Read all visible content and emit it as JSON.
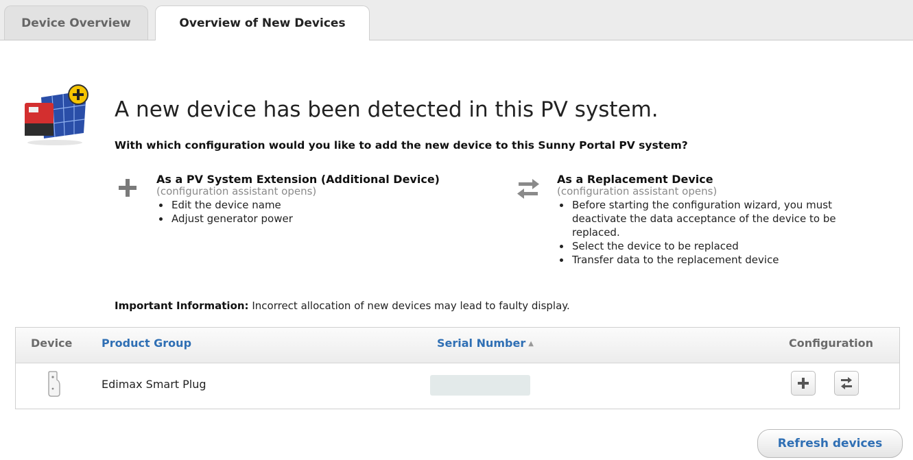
{
  "tabs": [
    {
      "label": "Device Overview",
      "active": false
    },
    {
      "label": "Overview of New Devices",
      "active": true
    }
  ],
  "hero": {
    "icon": "new-device-icon",
    "headline": "A new device has been detected in this PV system.",
    "question": "With which configuration would you like to add the new device to this Sunny Portal PV system?"
  },
  "options": {
    "extension": {
      "icon": "plus-icon",
      "title": "As a PV System Extension (Additional Device)",
      "subtitle": "(configuration assistant opens)",
      "items": [
        "Edit the device name",
        "Adjust generator power"
      ]
    },
    "replacement": {
      "icon": "swap-arrows-icon",
      "title": "As a Replacement Device",
      "subtitle": "(configuration assistant opens)",
      "items": [
        "Before starting the configuration wizard, you must deactivate the data acceptance of the device to be replaced.",
        "Select the device to be replaced",
        "Transfer data to the replacement device"
      ]
    }
  },
  "important": {
    "label": "Important Information:",
    "text": "Incorrect allocation of new devices may lead to faulty display."
  },
  "table": {
    "columns": {
      "device": "Device",
      "product_group": "Product Group",
      "serial_number": "Serial Number",
      "configuration": "Configuration"
    },
    "sort_icon": "sort-ascending-icon",
    "rows": [
      {
        "device_icon": "smart-plug-icon",
        "product_group": "Edimax Smart Plug",
        "serial_number": ""
      }
    ]
  },
  "refresh_button": "Refresh devices",
  "colors": {
    "link": "#2f6fb4",
    "accent": "#f5c400",
    "device_red": "#d32f2f",
    "panel_blue": "#2a4ea8"
  }
}
